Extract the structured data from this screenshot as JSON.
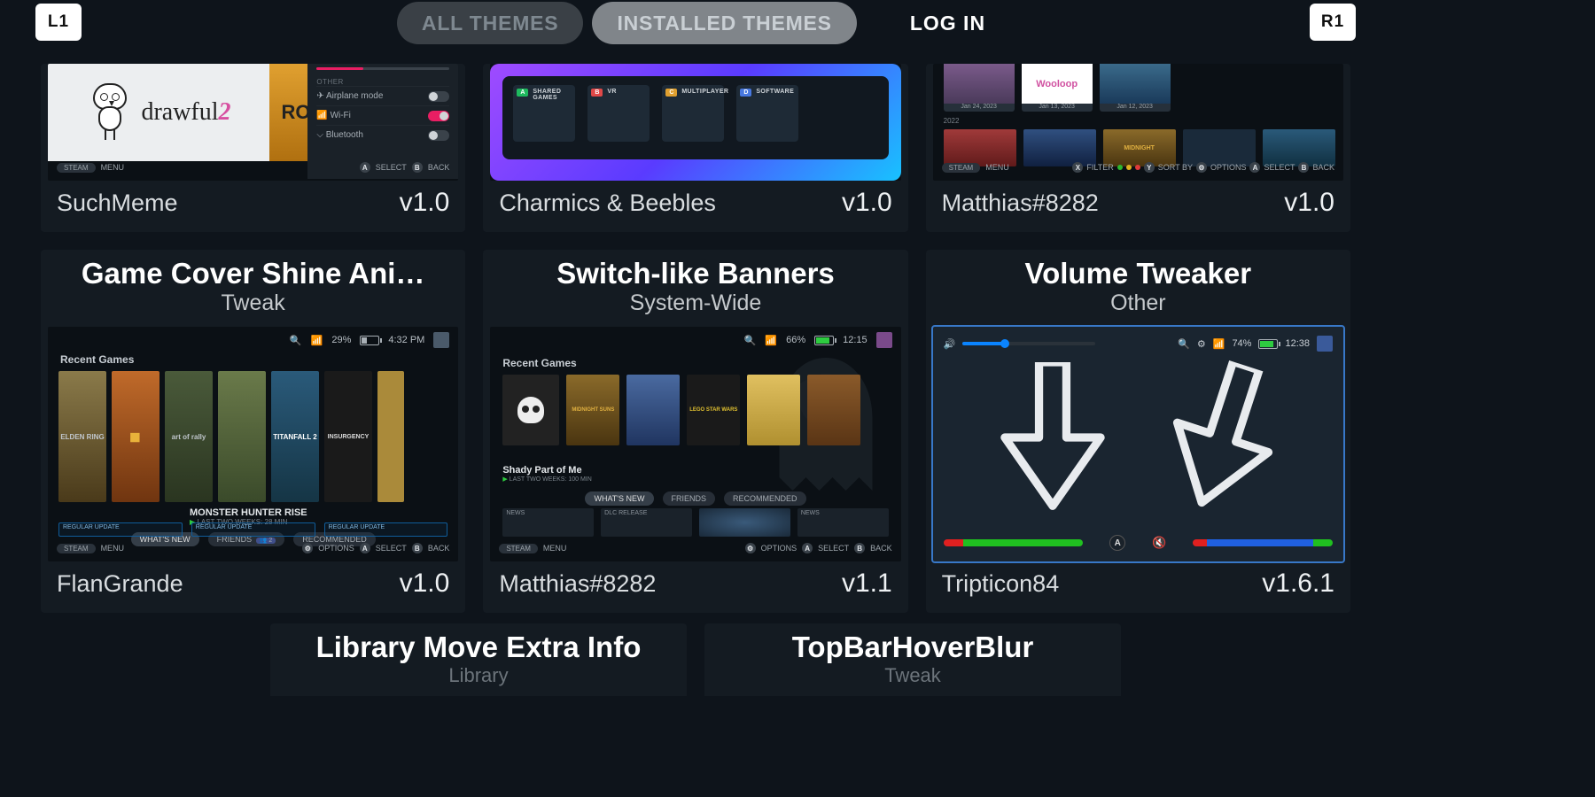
{
  "shoulders": {
    "left": "L1",
    "right": "R1"
  },
  "tabs": {
    "all_themes": "ALL THEMES",
    "installed_themes": "INSTALLED THEMES",
    "login": "LOG IN"
  },
  "cards_row1": [
    {
      "author": "SuchMeme",
      "version": "v1.0",
      "preview": {
        "logo": "drawful",
        "logo_suffix": "2",
        "panel_heading": "OTHER",
        "settings": [
          {
            "icon": "airplane-icon",
            "label": "Airplane mode",
            "state": "off"
          },
          {
            "icon": "wifi-icon",
            "label": "Wi-Fi",
            "state": "on"
          },
          {
            "icon": "bluetooth-icon",
            "label": "Bluetooth",
            "state": "off"
          }
        ],
        "footer_left": [
          "STEAM",
          "MENU"
        ],
        "footer_right": [
          {
            "glyph": "A",
            "label": "SELECT"
          },
          {
            "glyph": "B",
            "label": "BACK"
          }
        ]
      }
    },
    {
      "author": "Charmics & Beebles",
      "version": "v1.0",
      "preview": {
        "tiles": [
          {
            "tag": "A",
            "color": "#1eb95e",
            "label": "SHARED GAMES"
          },
          {
            "tag": "B",
            "color": "#e04848",
            "label": "VR"
          },
          {
            "tag": "C",
            "color": "#e0a030",
            "label": "MULTIPLAYER"
          },
          {
            "tag": "D",
            "color": "#4878e0",
            "label": "SOFTWARE"
          }
        ]
      }
    },
    {
      "author": "Matthias#8282",
      "version": "v1.0",
      "preview": {
        "row1": [
          {
            "img": "thumb",
            "date": "Jan 24, 2023"
          },
          {
            "img": "wooloop",
            "date": "Jan 13, 2023"
          },
          {
            "img": "thumb",
            "date": "Jan 12, 2023"
          }
        ],
        "year_divider": "2022",
        "footer_left": [
          "STEAM",
          "MENU"
        ],
        "footer_right": [
          {
            "glyph": "X",
            "label": "FILTER"
          },
          {
            "glyph": "Y",
            "label": "SORT BY"
          },
          {
            "glyph": "⚙",
            "label": "OPTIONS"
          },
          {
            "glyph": "A",
            "label": "SELECT"
          },
          {
            "glyph": "B",
            "label": "BACK"
          }
        ]
      }
    }
  ],
  "cards_row2": [
    {
      "title": "Game Cover Shine Ani…",
      "subtitle": "Tweak",
      "author": "FlanGrande",
      "version": "v1.0",
      "preview": {
        "status": {
          "pct": "29%",
          "time": "4:32 PM"
        },
        "section": "Recent Games",
        "covers": [
          "ELDEN RING",
          "",
          "art of rally",
          "MONSTER HUNTER",
          "TITANFALL 2",
          "INSURGENCY",
          ""
        ],
        "featured_title": "MONSTER HUNTER RISE",
        "featured_sub": "LAST TWO WEEKS: 28 MIN",
        "chips": [
          "WHAT'S NEW",
          "FRIENDS",
          "RECOMMENDED"
        ],
        "friends_badge": "2",
        "updates": [
          "REGULAR UPDATE",
          "REGULAR UPDATE",
          "REGULAR UPDATE"
        ],
        "footer_left": [
          "STEAM",
          "MENU"
        ],
        "footer_right": [
          {
            "glyph": "⚙",
            "label": "OPTIONS"
          },
          {
            "glyph": "A",
            "label": "SELECT"
          },
          {
            "glyph": "B",
            "label": "BACK"
          }
        ]
      }
    },
    {
      "title": "Switch-like Banners",
      "subtitle": "System-Wide",
      "author": "Matthias#8282",
      "version": "v1.1",
      "preview": {
        "status": {
          "pct": "66%",
          "time": "12:15"
        },
        "section": "Recent Games",
        "featured_title": "Shady Part of Me",
        "featured_sub": "LAST TWO WEEKS: 100 MIN",
        "covers": [
          "SHADY PART OF ME",
          "MIDNIGHT SUNS",
          "",
          "STAR WARS",
          "",
          ""
        ],
        "chips": [
          "WHAT'S NEW",
          "FRIENDS",
          "RECOMMENDED"
        ],
        "news": [
          "NEWS",
          "DLC RELEASE",
          "NEWS"
        ],
        "footer_left": [
          "STEAM",
          "MENU"
        ],
        "footer_right": [
          {
            "glyph": "⚙",
            "label": "OPTIONS"
          },
          {
            "glyph": "A",
            "label": "SELECT"
          },
          {
            "glyph": "B",
            "label": "BACK"
          }
        ]
      }
    },
    {
      "title": "Volume Tweaker",
      "subtitle": "Other",
      "author": "Tripticon84",
      "version": "v1.6.1",
      "preview": {
        "status": {
          "pct": "74%",
          "time": "12:38"
        },
        "a_glyph": "A"
      }
    }
  ],
  "cards_row3": [
    {
      "title": "Library Move Extra Info",
      "subtitle": "Library"
    },
    {
      "title": "TopBarHoverBlur",
      "subtitle": "Tweak"
    }
  ]
}
